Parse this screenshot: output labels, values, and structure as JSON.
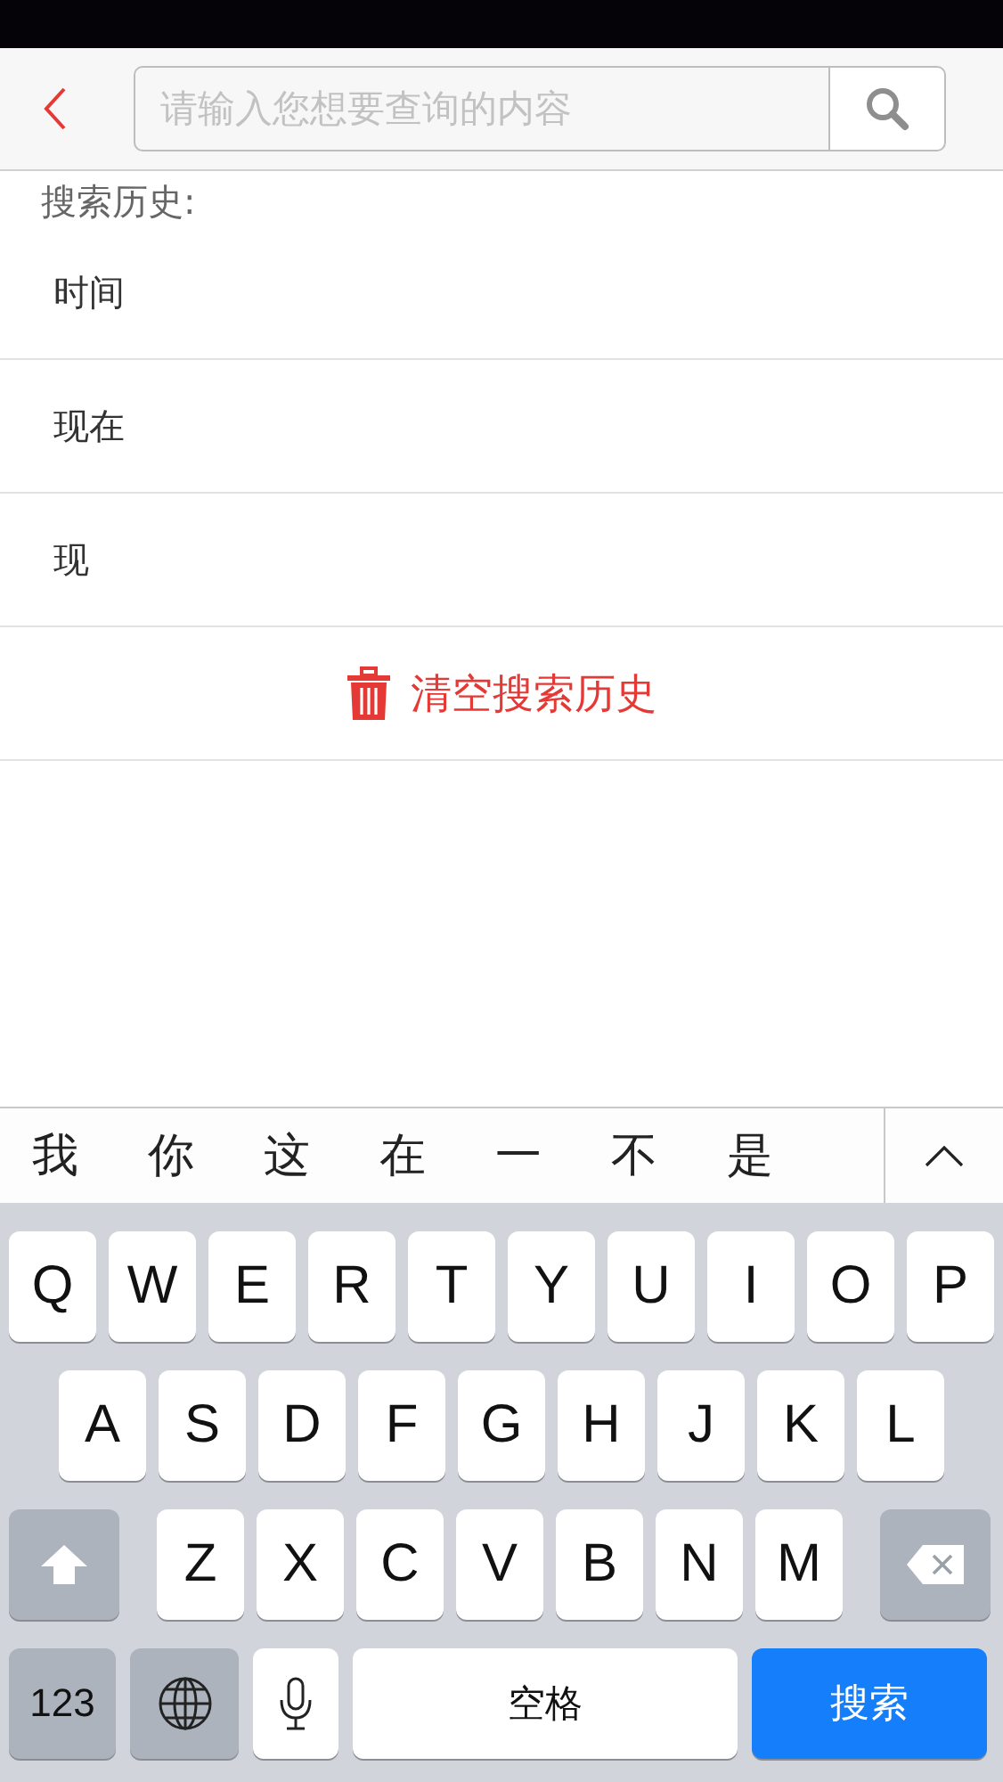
{
  "search": {
    "placeholder": "请输入您想要查询的内容"
  },
  "history_title": "搜索历史:",
  "history": [
    "时间",
    "现在",
    "现"
  ],
  "clear_button": "清空搜索历史",
  "candidates": [
    "我",
    "你",
    "这",
    "在",
    "一",
    "不",
    "是"
  ],
  "keyboard": {
    "rows": [
      [
        {
          "kind": "letter",
          "label": "Q"
        },
        {
          "kind": "letter",
          "label": "W"
        },
        {
          "kind": "letter",
          "label": "E"
        },
        {
          "kind": "letter",
          "label": "R"
        },
        {
          "kind": "letter",
          "label": "T"
        },
        {
          "kind": "letter",
          "label": "Y"
        },
        {
          "kind": "letter",
          "label": "U"
        },
        {
          "kind": "letter",
          "label": "I"
        },
        {
          "kind": "letter",
          "label": "O"
        },
        {
          "kind": "letter",
          "label": "P"
        }
      ],
      [
        {
          "kind": "letter",
          "label": "A"
        },
        {
          "kind": "letter",
          "label": "S"
        },
        {
          "kind": "letter",
          "label": "D"
        },
        {
          "kind": "letter",
          "label": "F"
        },
        {
          "kind": "letter",
          "label": "G"
        },
        {
          "kind": "letter",
          "label": "H"
        },
        {
          "kind": "letter",
          "label": "J"
        },
        {
          "kind": "letter",
          "label": "K"
        },
        {
          "kind": "letter",
          "label": "L"
        }
      ],
      [
        {
          "kind": "shift"
        },
        {
          "kind": "letter",
          "label": "Z"
        },
        {
          "kind": "letter",
          "label": "X"
        },
        {
          "kind": "letter",
          "label": "C"
        },
        {
          "kind": "letter",
          "label": "V"
        },
        {
          "kind": "letter",
          "label": "B"
        },
        {
          "kind": "letter",
          "label": "N"
        },
        {
          "kind": "letter",
          "label": "M"
        },
        {
          "kind": "backspace"
        }
      ]
    ],
    "bottom_bar": [
      {
        "kind": "numbers",
        "label": "123"
      },
      {
        "kind": "globe"
      },
      {
        "kind": "mic"
      },
      {
        "kind": "space",
        "label": "空格"
      },
      {
        "kind": "action",
        "label": "搜索"
      }
    ]
  }
}
